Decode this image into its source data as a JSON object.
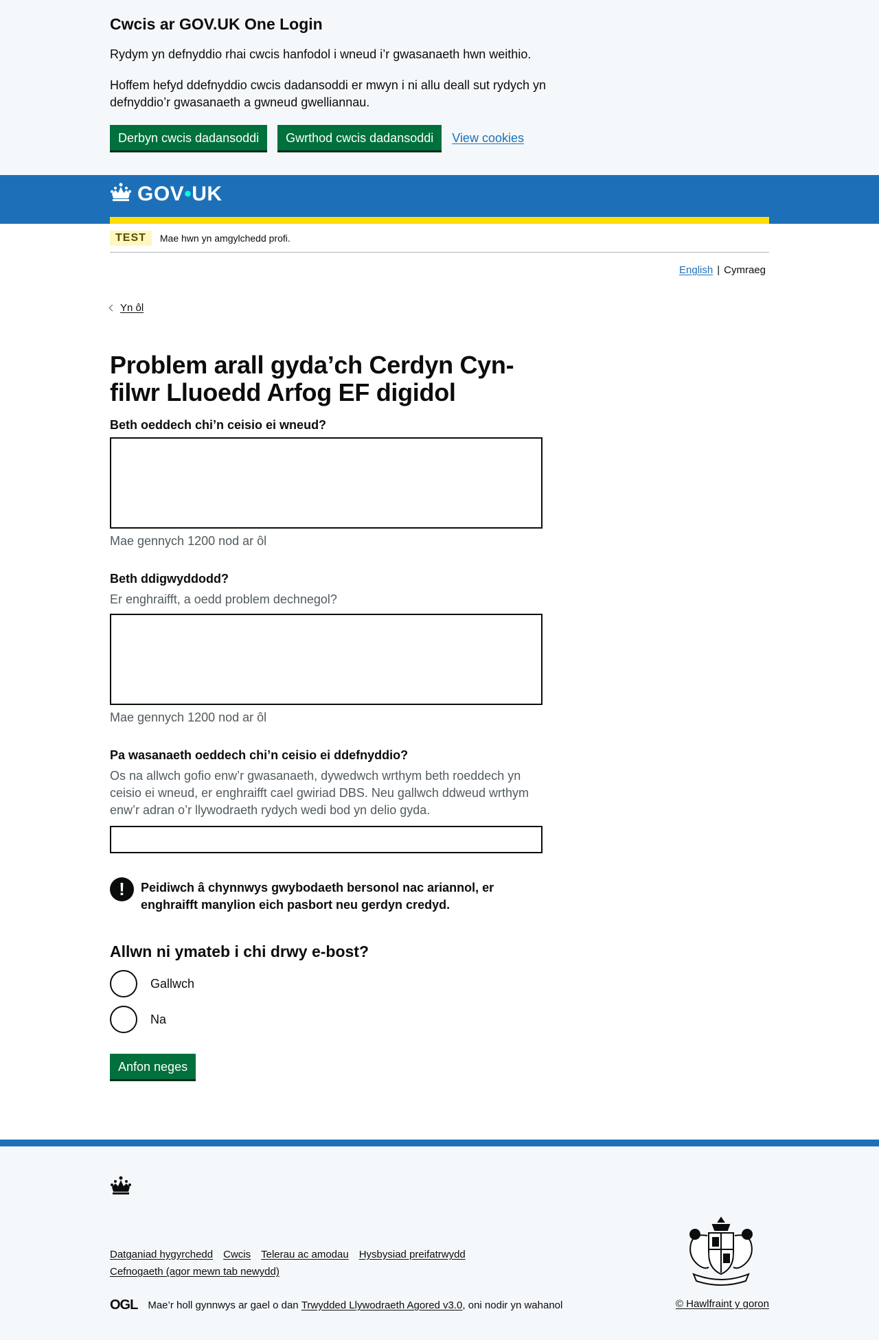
{
  "cookie_banner": {
    "title": "Cwcis ar GOV.UK One Login",
    "para1": "Rydym yn defnyddio rhai cwcis hanfodol i wneud i’r gwasanaeth hwn weithio.",
    "para2": "Hoffem hefyd ddefnyddio cwcis dadansoddi er mwyn i ni allu deall sut rydych yn defnyddio’r gwasanaeth a gwneud gwelliannau.",
    "accept": "Derbyn cwcis dadansoddi",
    "reject": "Gwrthod cwcis dadansoddi",
    "view": "View cookies"
  },
  "header": {
    "logo_left": "GOV",
    "logo_dot": "•",
    "logo_right": "UK"
  },
  "phase": {
    "tag": "TEST",
    "text": "Mae hwn yn amgylchedd profi."
  },
  "language": {
    "english": "English",
    "separator": "|",
    "cymraeg": "Cymraeg"
  },
  "back": "Yn ôl",
  "form": {
    "title": "Problem arall gyda’ch Cerdyn Cyn-filwr Lluoedd Arfog EF digidol",
    "q1_label": "Beth oeddech chi’n ceisio ei wneud?",
    "q1_count": "Mae gennych 1200 nod ar ôl",
    "q2_label": "Beth ddigwyddodd?",
    "q2_hint": "Er enghraifft, a oedd problem dechnegol?",
    "q2_count": "Mae gennych 1200 nod ar ôl",
    "q3_label": "Pa wasanaeth oeddech chi’n ceisio ei ddefnyddio?",
    "q3_hint": "Os na allwch gofio enw’r gwasanaeth, dywedwch wrthym beth roeddech yn ceisio ei wneud, er enghraifft cael gwiriad DBS. Neu gallwch ddweud wrthym enw’r adran o’r llywodraeth rydych wedi bod yn delio gyda.",
    "warning_icon": "!",
    "warning": "Peidiwch â chynnwys gwybodaeth bersonol nac ariannol, er enghraifft manylion eich pasbort neu gerdyn credyd.",
    "reply_heading": "Allwn ni ymateb i chi drwy e-bost?",
    "option_yes": "Gallwch",
    "option_no": "Na",
    "submit": "Anfon neges"
  },
  "footer": {
    "links": [
      "Datganiad hygyrchedd",
      "Cwcis",
      "Telerau ac amodau",
      "Hysbysiad preifatrwydd",
      "Cefnogaeth (agor mewn tab newydd)"
    ],
    "ogl": "OGL",
    "licence_pre": "Mae’r holl gynnwys ar gael o dan ",
    "licence_link": "Trwydded Llywodraeth Agored v3.0",
    "licence_post": ", oni nodir yn wahanol",
    "copyright": "© Hawlfraint y goron"
  },
  "colors": {
    "brand_blue": "#1d70b8",
    "button_green": "#00703c",
    "yellow": "#ffdd00"
  },
  "icons": [
    "crown-icon",
    "crest-icon",
    "chevron-left-icon",
    "warning-icon"
  ]
}
